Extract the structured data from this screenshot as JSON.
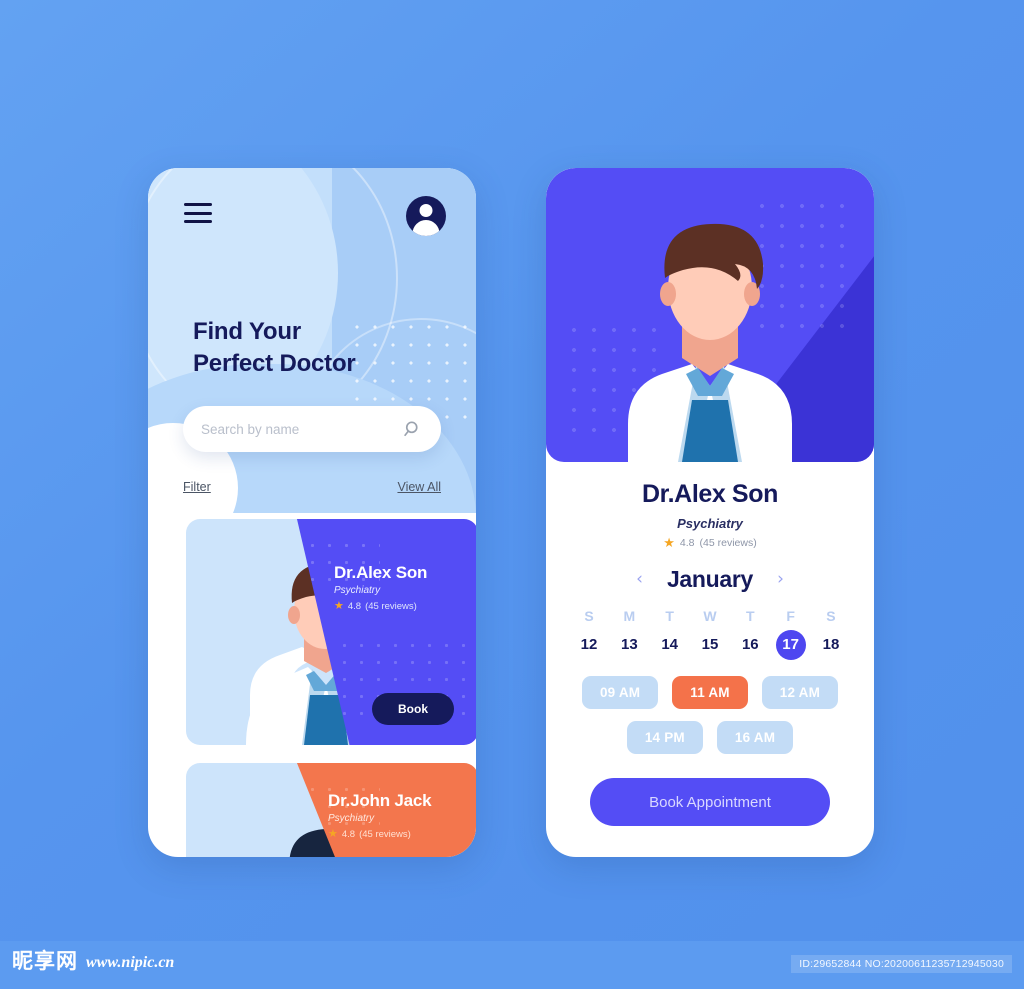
{
  "background_color": "#5C9BF0",
  "left_phone": {
    "header": {
      "menu_icon": "hamburger-icon",
      "avatar_icon": "user-avatar-icon"
    },
    "hero_title_line1": "Find Your",
    "hero_title_line2": "Perfect Doctor",
    "search": {
      "placeholder": "Search by name",
      "value": "",
      "icon": "search-icon"
    },
    "links": {
      "filter": "Filter",
      "view_all": "View All"
    },
    "doctor_cards": [
      {
        "name": "Dr.Alex Son",
        "specialty": "Psychiatry",
        "rating": "4.8",
        "reviews": "(45 reviews)",
        "button_label": "Book",
        "accent": "#544df5"
      },
      {
        "name": "Dr.John Jack",
        "specialty": "Psychiatry",
        "rating": "4.8",
        "reviews": "(45 reviews)",
        "button_label": "",
        "accent": "#f3764d"
      }
    ]
  },
  "right_phone": {
    "doctor": {
      "name": "Dr.Alex Son",
      "specialty": "Psychiatry",
      "rating": "4.8",
      "reviews": "(45 reviews)"
    },
    "calendar": {
      "month": "January",
      "prev_label": "‹",
      "next_label": "›",
      "day_names": [
        "S",
        "M",
        "T",
        "W",
        "T",
        "F",
        "S"
      ],
      "dates": [
        {
          "num": "12",
          "selected": false
        },
        {
          "num": "13",
          "selected": false
        },
        {
          "num": "14",
          "selected": false
        },
        {
          "num": "15",
          "selected": false
        },
        {
          "num": "16",
          "selected": false
        },
        {
          "num": "17",
          "selected": true
        },
        {
          "num": "18",
          "selected": false
        }
      ]
    },
    "time_slots_row1": [
      {
        "label": "09 AM",
        "selected": false
      },
      {
        "label": "11 AM",
        "selected": true
      },
      {
        "label": "12 AM",
        "selected": false
      }
    ],
    "time_slots_row2": [
      {
        "label": "14 PM",
        "selected": false
      },
      {
        "label": "16 AM",
        "selected": false
      }
    ],
    "book_button": "Book Appointment"
  },
  "footer": {
    "site_name_cn": "昵享网",
    "site_url": "www.nipic.cn",
    "id_text": "ID:29652844 NO:20200611235712945030"
  }
}
